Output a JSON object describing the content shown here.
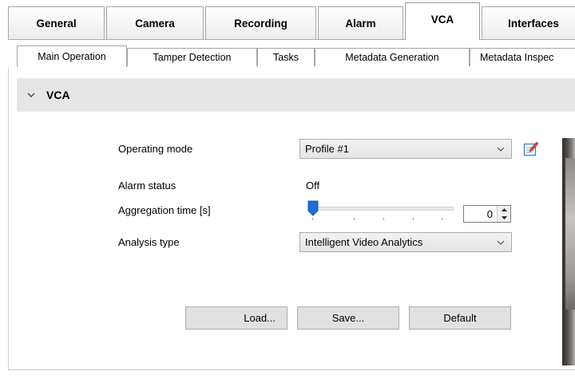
{
  "main_tabs": [
    {
      "label": "General",
      "active": false
    },
    {
      "label": "Camera",
      "active": false
    },
    {
      "label": "Recording",
      "active": false
    },
    {
      "label": "Alarm",
      "active": false
    },
    {
      "label": "VCA",
      "active": true
    },
    {
      "label": "Interfaces",
      "active": false
    }
  ],
  "sub_tabs": [
    {
      "label": "Main Operation",
      "active": true
    },
    {
      "label": "Tamper Detection",
      "active": false
    },
    {
      "label": "Tasks",
      "active": false
    },
    {
      "label": "Metadata Generation",
      "active": false
    },
    {
      "label": "Metadata Inspec",
      "active": false
    }
  ],
  "section": {
    "title": "VCA",
    "expanded": true,
    "icon": "chevron-down-icon"
  },
  "form": {
    "operating_mode": {
      "label": "Operating mode",
      "value": "Profile #1",
      "icon": "edit-profile-icon"
    },
    "alarm_status": {
      "label": "Alarm status",
      "value": "Off"
    },
    "aggregation_time": {
      "label": "Aggregation time [s]",
      "value": "0",
      "slider_fraction": 0
    },
    "analysis_type": {
      "label": "Analysis type",
      "value": "Intelligent Video Analytics"
    }
  },
  "buttons": {
    "load": "Load...",
    "save": "Save...",
    "default": "Default"
  },
  "colors": {
    "section_header_bg": "#e6e6e6",
    "slider_thumb": "#1e6fd9",
    "button_bg": "#e1e1e1"
  }
}
